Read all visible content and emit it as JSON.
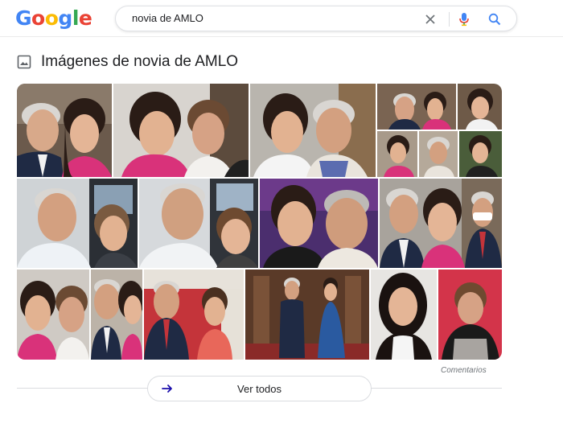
{
  "header": {
    "logo_letters": [
      "G",
      "o",
      "o",
      "g",
      "l",
      "e"
    ],
    "logo_colors": [
      "#4285f4",
      "#ea4335",
      "#fbbc05",
      "#4285f4",
      "#34a853",
      "#ea4335"
    ],
    "search_value": "novia de AMLO",
    "icons": [
      "clear-icon",
      "microphone-icon",
      "search-icon"
    ]
  },
  "images_section": {
    "title": "Imágenes de novia de AMLO",
    "comments_label": "Comentarios",
    "view_all_label": "Ver todos",
    "tiles": [
      {
        "desc": "Man in suit with young woman in pink, selfie"
      },
      {
        "desc": "Two women smiling, one in pink"
      },
      {
        "desc": "Young woman with older man, selfie"
      },
      {
        "desc": "Collage of four photos"
      },
      {
        "desc": "Man and woman selfie in car"
      },
      {
        "desc": "Man and woman selfie in car, close"
      },
      {
        "desc": "Young woman and man, purple background"
      },
      {
        "desc": "Man, young woman, man with mask"
      },
      {
        "desc": "Two women and man collage"
      },
      {
        "desc": "Man and woman in red room"
      },
      {
        "desc": "Couple in formal wear, palace hall"
      },
      {
        "desc": "Woman with long dark hair, white top"
      },
      {
        "desc": "Woman in black, red background"
      }
    ]
  },
  "colors": {
    "skin": "#e0b091",
    "hair_dark": "#2a1c16",
    "hair_grey": "#c9c6c2",
    "suit": "#1f2a44",
    "pink": "#d9327a",
    "red_wall": "#c4343a"
  }
}
